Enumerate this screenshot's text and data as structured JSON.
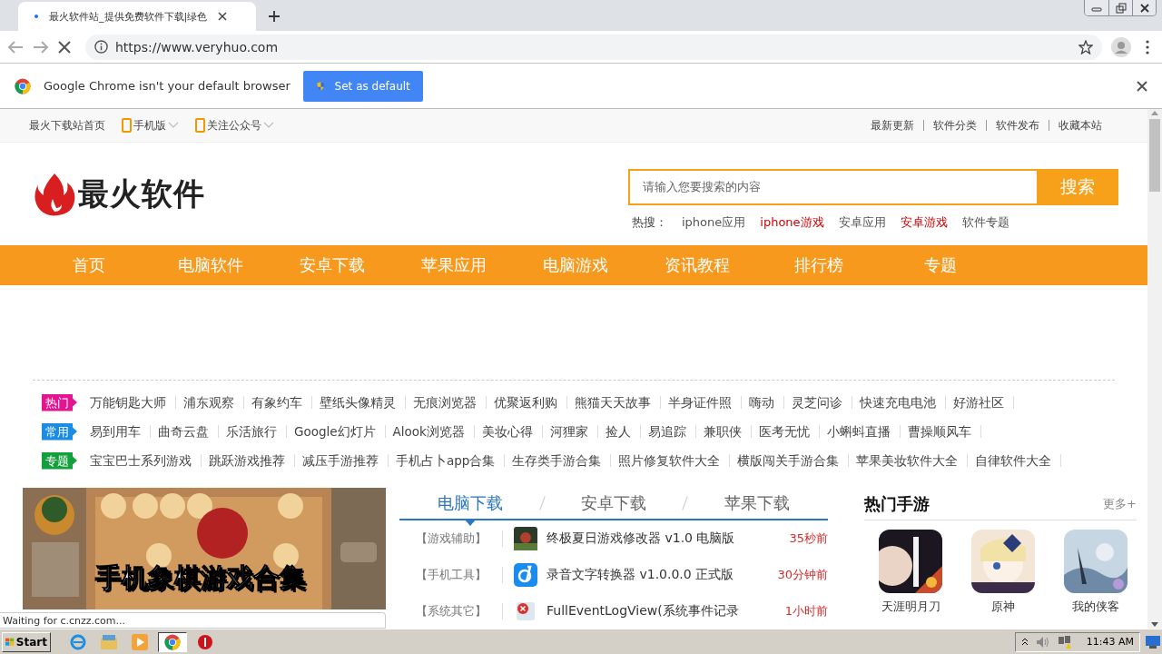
{
  "browser": {
    "tab": {
      "title": "最火软件站_提供免费软件下载|绿色"
    },
    "address": "https://www.veryhuo.com"
  },
  "infobar": {
    "message": "Google Chrome isn't your default browser",
    "button": "Set as default"
  },
  "topbar": {
    "left": [
      {
        "label": "最火下载站首页",
        "kind": "link"
      },
      {
        "label": "手机版",
        "kind": "dropdown"
      },
      {
        "label": "关注公众号",
        "kind": "dropdown"
      }
    ],
    "right": [
      "最新更新",
      "软件分类",
      "软件发布",
      "收藏本站"
    ]
  },
  "logo": {
    "text": "最火软件"
  },
  "search": {
    "placeholder": "请输入您要搜索的内容",
    "button": "搜索"
  },
  "hot_search": {
    "label": "热搜：",
    "items": [
      {
        "label": "iphone应用",
        "color": "#555555"
      },
      {
        "label": "iphone游戏",
        "color": "#cc0000"
      },
      {
        "label": "安卓应用",
        "color": "#555555"
      },
      {
        "label": "安卓游戏",
        "color": "#cc0000"
      },
      {
        "label": "软件专题",
        "color": "#555555"
      }
    ]
  },
  "nav": [
    "首页",
    "电脑软件",
    "安卓下载",
    "苹果应用",
    "电脑游戏",
    "资讯教程",
    "排行榜",
    "专题"
  ],
  "tag_rows": [
    {
      "label": "热门",
      "color": "#e5148f",
      "items": [
        "万能钥匙大师",
        "浦东观察",
        "有象约车",
        "壁纸头像精灵",
        "无痕浏览器",
        "优聚返利购",
        "熊猫天天故事",
        "半身证件照",
        "嗨动",
        "灵芝问诊",
        "快速充电电池",
        "好游社区"
      ]
    },
    {
      "label": "常用",
      "color": "#1a8ce6",
      "items": [
        "易到用车",
        "曲奇云盘",
        "乐活旅行",
        "Google幻灯片",
        "Alook浏览器",
        "美妆心得",
        "河狸家",
        "捡人",
        "易追踪",
        "兼职侠",
        "医考无忧",
        "小蝌蚪直播",
        "曹操顺风车"
      ]
    },
    {
      "label": "专题",
      "color": "#13a03c",
      "items": [
        "宝宝巴士系列游戏",
        "跳跃游戏推荐",
        "减压手游推荐",
        "手机占卜app合集",
        "生存类手游合集",
        "照片修复软件大全",
        "横版闯关手游合集",
        "苹果美妆软件大全",
        "自律软件大全"
      ]
    }
  ],
  "banner": {
    "caption": "手机象棋游戏合集"
  },
  "downloads": {
    "tabs": [
      {
        "label": "电脑下载",
        "selected": true
      },
      {
        "label": "安卓下载",
        "selected": false
      },
      {
        "label": "苹果下载",
        "selected": false
      }
    ],
    "rows": [
      {
        "category": "【游戏辅助】",
        "title": "终极夏日游戏修改器 v1.0 电脑版",
        "time": "35秒前"
      },
      {
        "category": "【手机工具】",
        "title": "录音文字转换器 v1.0.0.0 正式版",
        "time": "30分钟前"
      },
      {
        "category": "【系统其它】",
        "title": "FullEventLogView(系统事件记录",
        "time": "1小时前"
      }
    ]
  },
  "hot_games": {
    "title": "热门手游",
    "more": "更多+",
    "games": [
      "天涯明月刀",
      "原神",
      "我的侠客"
    ]
  },
  "status_bubble": "Waiting for c.cnzz.com...",
  "taskbar": {
    "start": "Start",
    "clock": "11:43 AM"
  }
}
